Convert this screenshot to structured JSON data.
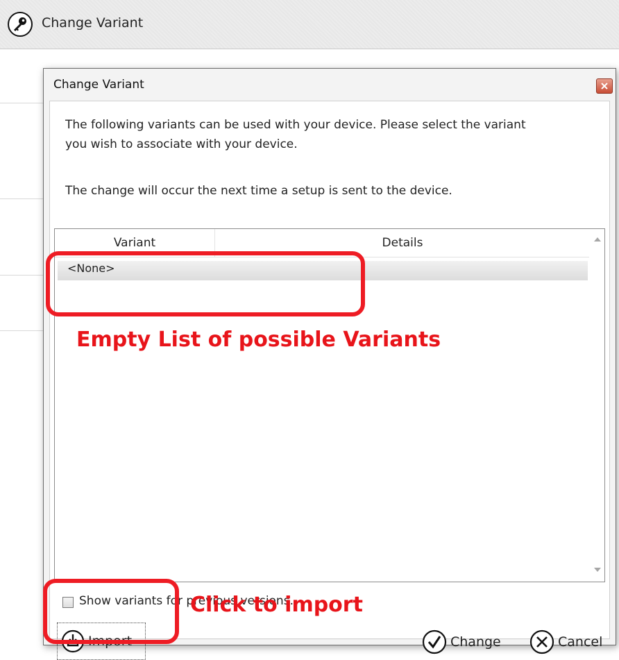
{
  "app": {
    "title": "Change Variant",
    "icon": "key-icon"
  },
  "dialog": {
    "title": "Change Variant",
    "close_icon": "close-icon",
    "message_line1": "The following variants can be used with your device. Please select the variant",
    "message_line2": "you wish to associate with your device.",
    "message_line3": "The change will occur the next time a setup is sent to the device.",
    "list": {
      "columns": [
        "Variant",
        "Details"
      ],
      "rows": [
        {
          "variant": "<None>",
          "details": ""
        }
      ]
    },
    "show_previous_label": "Show variants for previous versions.",
    "show_previous_checked": false,
    "buttons": {
      "import": "Import",
      "change": "Change",
      "cancel": "Cancel"
    }
  },
  "annotations": {
    "list_note": "Empty List of possible Variants",
    "import_note": "Click to import",
    "color": "#ee1c24"
  }
}
